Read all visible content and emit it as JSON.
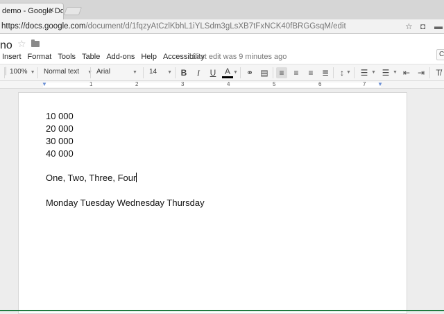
{
  "browser": {
    "tab_title": "demo - Google Docs",
    "tab_close": "✕",
    "url_domain": "https://docs.google.com",
    "url_path": "/document/d/1fqzyAtCzlKbhL1iYLSdm3gLsXB7tFxNCK40fBRGGsqM/edit"
  },
  "doc": {
    "title": "no",
    "star": "☆",
    "menu": [
      "Insert",
      "Format",
      "Tools",
      "Table",
      "Add-ons",
      "Help",
      "Accessibility"
    ],
    "last_edit": "Last edit was 9 minutes ago",
    "corner": "C"
  },
  "toolbar": {
    "zoom": "100%",
    "style": "Normal text",
    "font": "Arial",
    "size": "14",
    "bold": "B",
    "italic": "I",
    "underline": "U",
    "text_color": "A"
  },
  "ruler": [
    "1",
    "2",
    "3",
    "4",
    "5",
    "6",
    "7"
  ],
  "content": {
    "lines": [
      "10 000",
      "20 000",
      "30 000",
      "40 000"
    ],
    "words_line": "One, Two, Three, Four",
    "days_line": "Monday Tuesday Wednesday Thursday"
  }
}
